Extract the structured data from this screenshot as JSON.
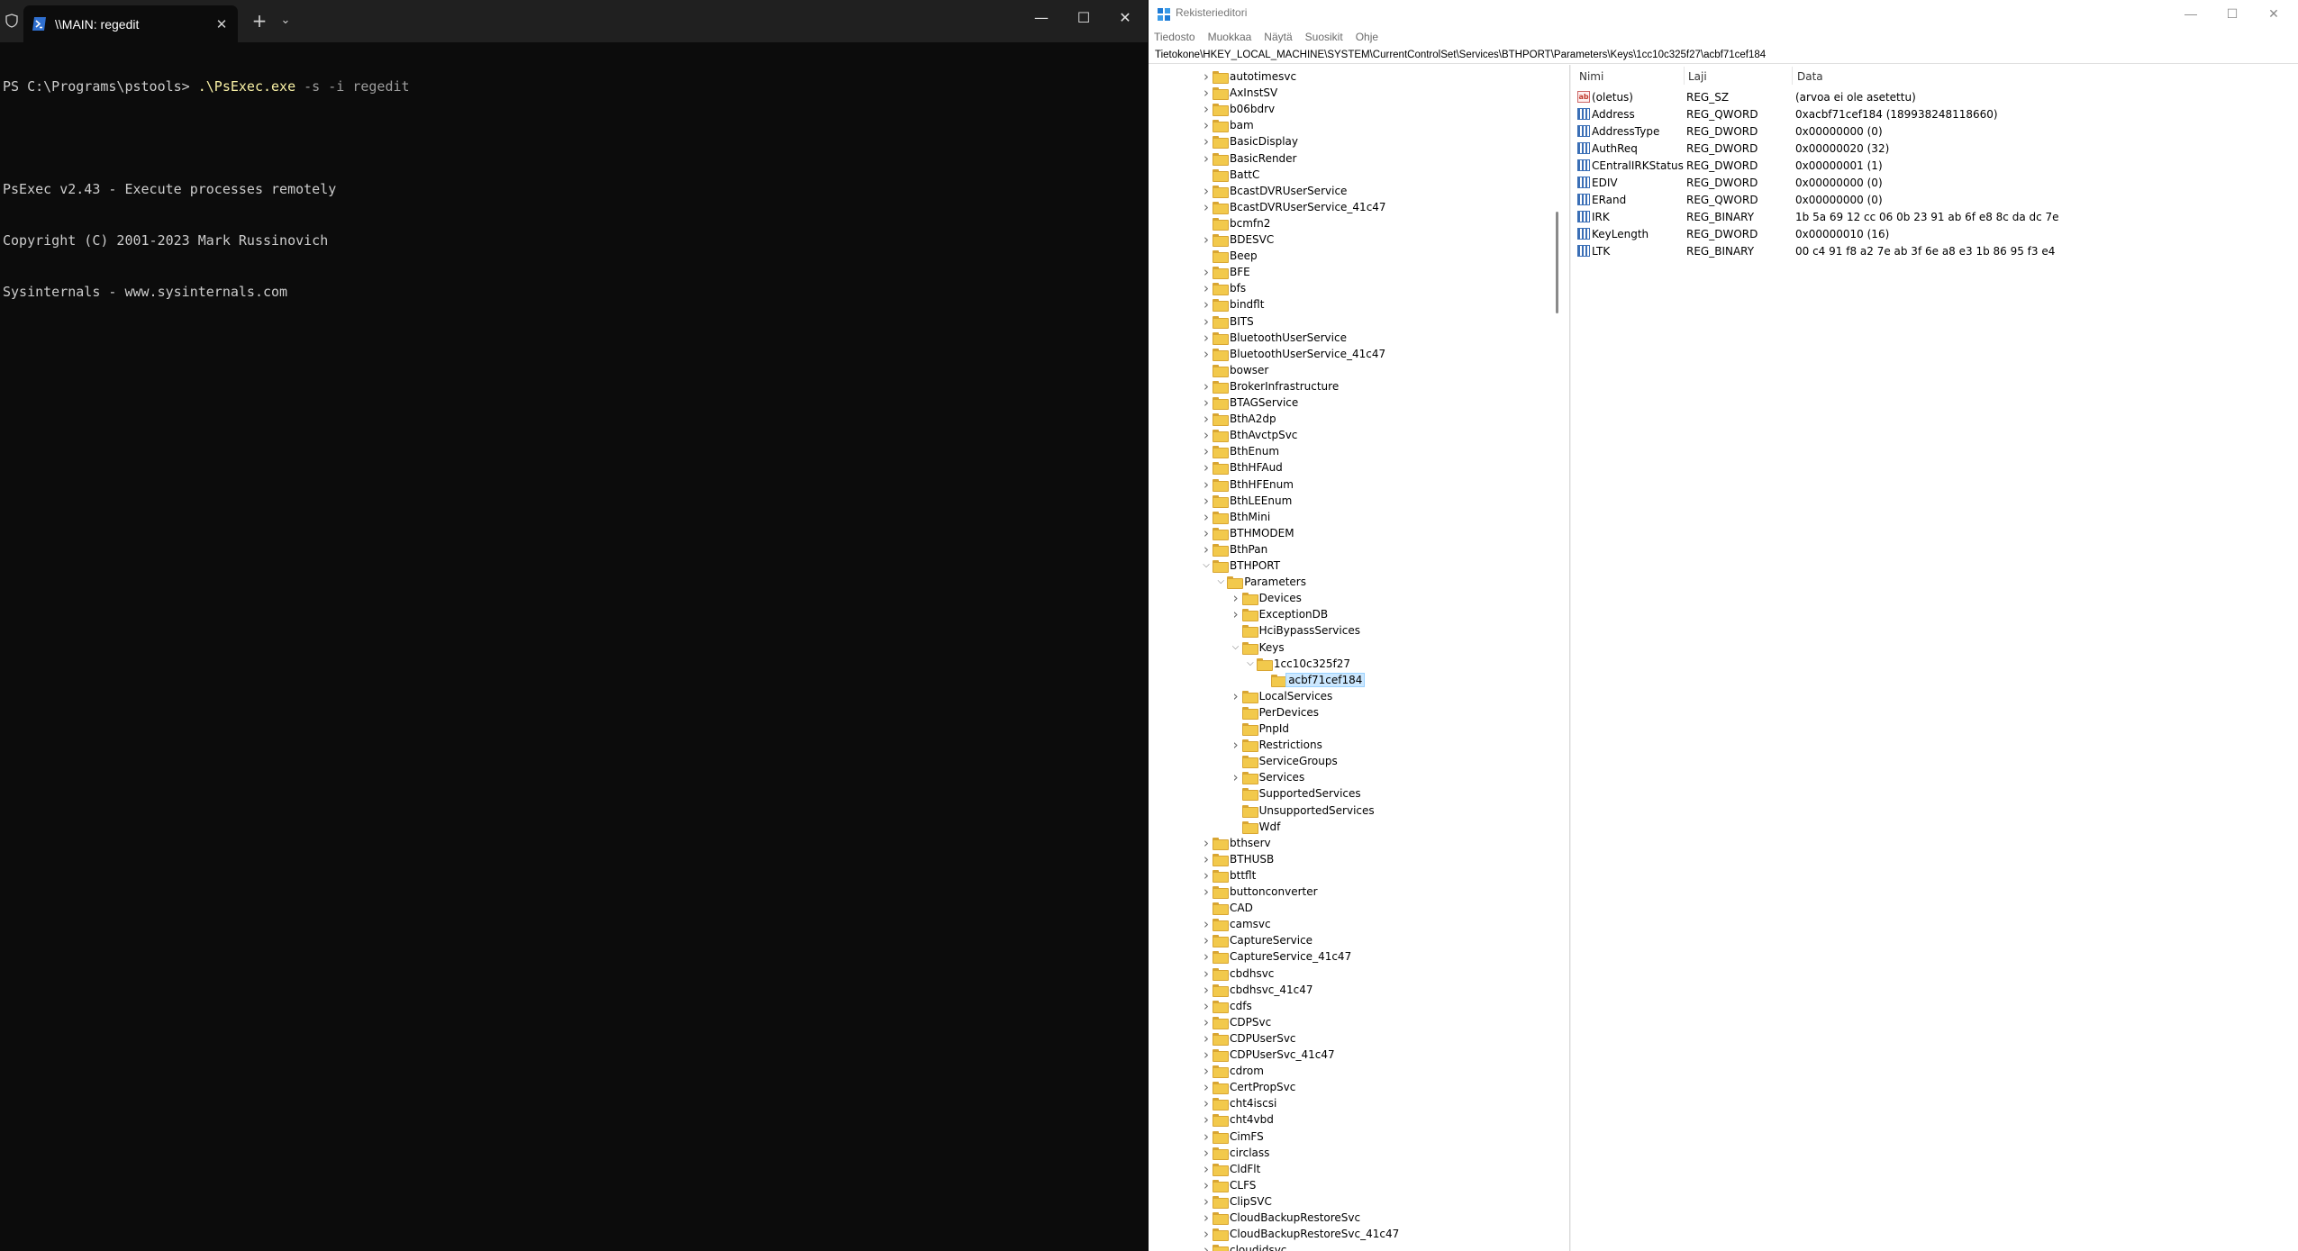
{
  "terminal": {
    "tab_title": "\\\\MAIN: regedit",
    "prompt": "PS C:\\Programs\\pstools> ",
    "command": ".\\PsExec.exe",
    "args": " -s -i regedit",
    "output": [
      "PsExec v2.43 - Execute processes remotely",
      "Copyright (C) 2001-2023 Mark Russinovich",
      "Sysinternals - www.sysinternals.com"
    ],
    "new_tab": "+",
    "dropdown": "⌄",
    "minimize": "—",
    "maximize": "☐",
    "close": "✕"
  },
  "regedit": {
    "title": "Rekisterieditori",
    "menu": [
      "Tiedosto",
      "Muokkaa",
      "Näytä",
      "Suosikit",
      "Ohje"
    ],
    "address": "Tietokone\\HKEY_LOCAL_MACHINE\\SYSTEM\\CurrentControlSet\\Services\\BTHPORT\\Parameters\\Keys\\1cc10c325f27\\acbf71cef184",
    "minimize": "—",
    "maximize": "☐",
    "close": "✕",
    "tree": [
      {
        "label": "autotimesvc",
        "depth": 0,
        "exp": "collapsed"
      },
      {
        "label": "AxInstSV",
        "depth": 0,
        "exp": "collapsed"
      },
      {
        "label": "b06bdrv",
        "depth": 0,
        "exp": "collapsed"
      },
      {
        "label": "bam",
        "depth": 0,
        "exp": "collapsed"
      },
      {
        "label": "BasicDisplay",
        "depth": 0,
        "exp": "collapsed"
      },
      {
        "label": "BasicRender",
        "depth": 0,
        "exp": "collapsed"
      },
      {
        "label": "BattC",
        "depth": 0,
        "exp": "none"
      },
      {
        "label": "BcastDVRUserService",
        "depth": 0,
        "exp": "collapsed"
      },
      {
        "label": "BcastDVRUserService_41c47",
        "depth": 0,
        "exp": "collapsed"
      },
      {
        "label": "bcmfn2",
        "depth": 0,
        "exp": "none"
      },
      {
        "label": "BDESVC",
        "depth": 0,
        "exp": "collapsed"
      },
      {
        "label": "Beep",
        "depth": 0,
        "exp": "none"
      },
      {
        "label": "BFE",
        "depth": 0,
        "exp": "collapsed"
      },
      {
        "label": "bfs",
        "depth": 0,
        "exp": "collapsed"
      },
      {
        "label": "bindflt",
        "depth": 0,
        "exp": "collapsed"
      },
      {
        "label": "BITS",
        "depth": 0,
        "exp": "collapsed"
      },
      {
        "label": "BluetoothUserService",
        "depth": 0,
        "exp": "collapsed"
      },
      {
        "label": "BluetoothUserService_41c47",
        "depth": 0,
        "exp": "collapsed"
      },
      {
        "label": "bowser",
        "depth": 0,
        "exp": "none"
      },
      {
        "label": "BrokerInfrastructure",
        "depth": 0,
        "exp": "collapsed"
      },
      {
        "label": "BTAGService",
        "depth": 0,
        "exp": "collapsed"
      },
      {
        "label": "BthA2dp",
        "depth": 0,
        "exp": "collapsed"
      },
      {
        "label": "BthAvctpSvc",
        "depth": 0,
        "exp": "collapsed"
      },
      {
        "label": "BthEnum",
        "depth": 0,
        "exp": "collapsed"
      },
      {
        "label": "BthHFAud",
        "depth": 0,
        "exp": "collapsed"
      },
      {
        "label": "BthHFEnum",
        "depth": 0,
        "exp": "collapsed"
      },
      {
        "label": "BthLEEnum",
        "depth": 0,
        "exp": "collapsed"
      },
      {
        "label": "BthMini",
        "depth": 0,
        "exp": "collapsed"
      },
      {
        "label": "BTHMODEM",
        "depth": 0,
        "exp": "collapsed"
      },
      {
        "label": "BthPan",
        "depth": 0,
        "exp": "collapsed"
      },
      {
        "label": "BTHPORT",
        "depth": 0,
        "exp": "expanded"
      },
      {
        "label": "Parameters",
        "depth": 1,
        "exp": "expanded"
      },
      {
        "label": "Devices",
        "depth": 2,
        "exp": "collapsed"
      },
      {
        "label": "ExceptionDB",
        "depth": 2,
        "exp": "collapsed"
      },
      {
        "label": "HciBypassServices",
        "depth": 2,
        "exp": "none"
      },
      {
        "label": "Keys",
        "depth": 2,
        "exp": "expanded"
      },
      {
        "label": "1cc10c325f27",
        "depth": 3,
        "exp": "expanded"
      },
      {
        "label": "acbf71cef184",
        "depth": 4,
        "exp": "none",
        "selected": true
      },
      {
        "label": "LocalServices",
        "depth": 2,
        "exp": "collapsed"
      },
      {
        "label": "PerDevices",
        "depth": 2,
        "exp": "none"
      },
      {
        "label": "PnpId",
        "depth": 2,
        "exp": "none"
      },
      {
        "label": "Restrictions",
        "depth": 2,
        "exp": "collapsed"
      },
      {
        "label": "ServiceGroups",
        "depth": 2,
        "exp": "none"
      },
      {
        "label": "Services",
        "depth": 2,
        "exp": "collapsed"
      },
      {
        "label": "SupportedServices",
        "depth": 2,
        "exp": "none"
      },
      {
        "label": "UnsupportedServices",
        "depth": 2,
        "exp": "none"
      },
      {
        "label": "Wdf",
        "depth": 2,
        "exp": "none"
      },
      {
        "label": "bthserv",
        "depth": 0,
        "exp": "collapsed"
      },
      {
        "label": "BTHUSB",
        "depth": 0,
        "exp": "collapsed"
      },
      {
        "label": "bttflt",
        "depth": 0,
        "exp": "collapsed"
      },
      {
        "label": "buttonconverter",
        "depth": 0,
        "exp": "collapsed"
      },
      {
        "label": "CAD",
        "depth": 0,
        "exp": "none"
      },
      {
        "label": "camsvc",
        "depth": 0,
        "exp": "collapsed"
      },
      {
        "label": "CaptureService",
        "depth": 0,
        "exp": "collapsed"
      },
      {
        "label": "CaptureService_41c47",
        "depth": 0,
        "exp": "collapsed"
      },
      {
        "label": "cbdhsvc",
        "depth": 0,
        "exp": "collapsed"
      },
      {
        "label": "cbdhsvc_41c47",
        "depth": 0,
        "exp": "collapsed"
      },
      {
        "label": "cdfs",
        "depth": 0,
        "exp": "collapsed"
      },
      {
        "label": "CDPSvc",
        "depth": 0,
        "exp": "collapsed"
      },
      {
        "label": "CDPUserSvc",
        "depth": 0,
        "exp": "collapsed"
      },
      {
        "label": "CDPUserSvc_41c47",
        "depth": 0,
        "exp": "collapsed"
      },
      {
        "label": "cdrom",
        "depth": 0,
        "exp": "collapsed"
      },
      {
        "label": "CertPropSvc",
        "depth": 0,
        "exp": "collapsed"
      },
      {
        "label": "cht4iscsi",
        "depth": 0,
        "exp": "collapsed"
      },
      {
        "label": "cht4vbd",
        "depth": 0,
        "exp": "collapsed"
      },
      {
        "label": "CimFS",
        "depth": 0,
        "exp": "collapsed"
      },
      {
        "label": "circlass",
        "depth": 0,
        "exp": "collapsed"
      },
      {
        "label": "CldFlt",
        "depth": 0,
        "exp": "collapsed"
      },
      {
        "label": "CLFS",
        "depth": 0,
        "exp": "collapsed"
      },
      {
        "label": "ClipSVC",
        "depth": 0,
        "exp": "collapsed"
      },
      {
        "label": "CloudBackupRestoreSvc",
        "depth": 0,
        "exp": "collapsed"
      },
      {
        "label": "CloudBackupRestoreSvc_41c47",
        "depth": 0,
        "exp": "collapsed"
      },
      {
        "label": "cloudidsvc",
        "depth": 0,
        "exp": "collapsed"
      }
    ],
    "columns": {
      "name": "Nimi",
      "type": "Laji",
      "data": "Data"
    },
    "values": [
      {
        "icon": "string-value-icon",
        "name": "(oletus)",
        "type": "REG_SZ",
        "data": "(arvoa ei ole asetettu)"
      },
      {
        "icon": "binary-value-icon",
        "name": "Address",
        "type": "REG_QWORD",
        "data": "0xacbf71cef184 (189938248118660)"
      },
      {
        "icon": "binary-value-icon",
        "name": "AddressType",
        "type": "REG_DWORD",
        "data": "0x00000000 (0)"
      },
      {
        "icon": "binary-value-icon",
        "name": "AuthReq",
        "type": "REG_DWORD",
        "data": "0x00000020 (32)"
      },
      {
        "icon": "binary-value-icon",
        "name": "CEntralIRKStatus",
        "type": "REG_DWORD",
        "data": "0x00000001 (1)"
      },
      {
        "icon": "binary-value-icon",
        "name": "EDIV",
        "type": "REG_DWORD",
        "data": "0x00000000 (0)"
      },
      {
        "icon": "binary-value-icon",
        "name": "ERand",
        "type": "REG_QWORD",
        "data": "0x00000000 (0)"
      },
      {
        "icon": "binary-value-icon",
        "name": "IRK",
        "type": "REG_BINARY",
        "data": "1b 5a 69 12 cc 06 0b 23 91 ab 6f e8 8c da dc 7e"
      },
      {
        "icon": "binary-value-icon",
        "name": "KeyLength",
        "type": "REG_DWORD",
        "data": "0x00000010 (16)"
      },
      {
        "icon": "binary-value-icon",
        "name": "LTK",
        "type": "REG_BINARY",
        "data": "00 c4 91 f8 a2 7e ab 3f 6e a8 e3 1b 86 95 f3 e4"
      }
    ]
  },
  "colors": {
    "terminal_bg": "#0c0c0c",
    "terminal_fg": "#cccccc",
    "command_yellow": "#f9f1a5",
    "folder_yellow": "#f2c94c",
    "selection": "#cce8ff"
  }
}
